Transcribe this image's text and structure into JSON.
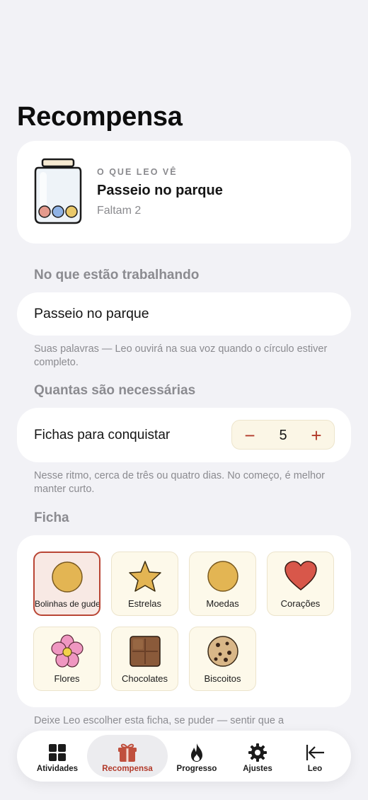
{
  "title": "Recompensa",
  "preview": {
    "eyebrow": "O QUE LEO VÊ",
    "reward": "Passeio no parque",
    "remaining": "Faltam 2"
  },
  "goal_section": {
    "label": "No que estão trabalhando",
    "value": "Passeio no parque",
    "helper": "Suas palavras — Leo ouvirá na sua voz quando o círculo estiver completo."
  },
  "count_section": {
    "label": "Quantas são necessárias",
    "row_label": "Fichas para conquistar",
    "value": "5",
    "minus": "−",
    "plus": "+",
    "helper": "Nesse ritmo, cerca de três ou quatro dias. No começo, é melhor manter curto."
  },
  "token_section": {
    "label": "Ficha",
    "options": [
      {
        "label": "Bolinhas de gude",
        "icon": "marble-icon",
        "selected": true
      },
      {
        "label": "Estrelas",
        "icon": "star-icon",
        "selected": false
      },
      {
        "label": "Moedas",
        "icon": "coin-icon",
        "selected": false
      },
      {
        "label": "Corações",
        "icon": "heart-icon",
        "selected": false
      },
      {
        "label": "Flores",
        "icon": "flower-icon",
        "selected": false
      },
      {
        "label": "Chocolates",
        "icon": "chocolate-icon",
        "selected": false
      },
      {
        "label": "Biscoitos",
        "icon": "cookie-icon",
        "selected": false
      }
    ],
    "helper": "Deixe Leo escolher esta ficha, se puder — sentir que a"
  },
  "tabs": [
    {
      "label": "Atividades",
      "icon": "grid-icon",
      "active": false
    },
    {
      "label": "Recompensa",
      "icon": "gift-icon",
      "active": true
    },
    {
      "label": "Progresso",
      "icon": "flame-icon",
      "active": false
    },
    {
      "label": "Ajustes",
      "icon": "gear-icon",
      "active": false
    },
    {
      "label": "Leo",
      "icon": "arrow-left-bar-icon",
      "active": false
    }
  ],
  "colors": {
    "accent": "#b23a2a",
    "background": "#f2f2f6",
    "card": "#ffffff",
    "muted": "#8b8b90",
    "token_gold": "#e3b553"
  }
}
